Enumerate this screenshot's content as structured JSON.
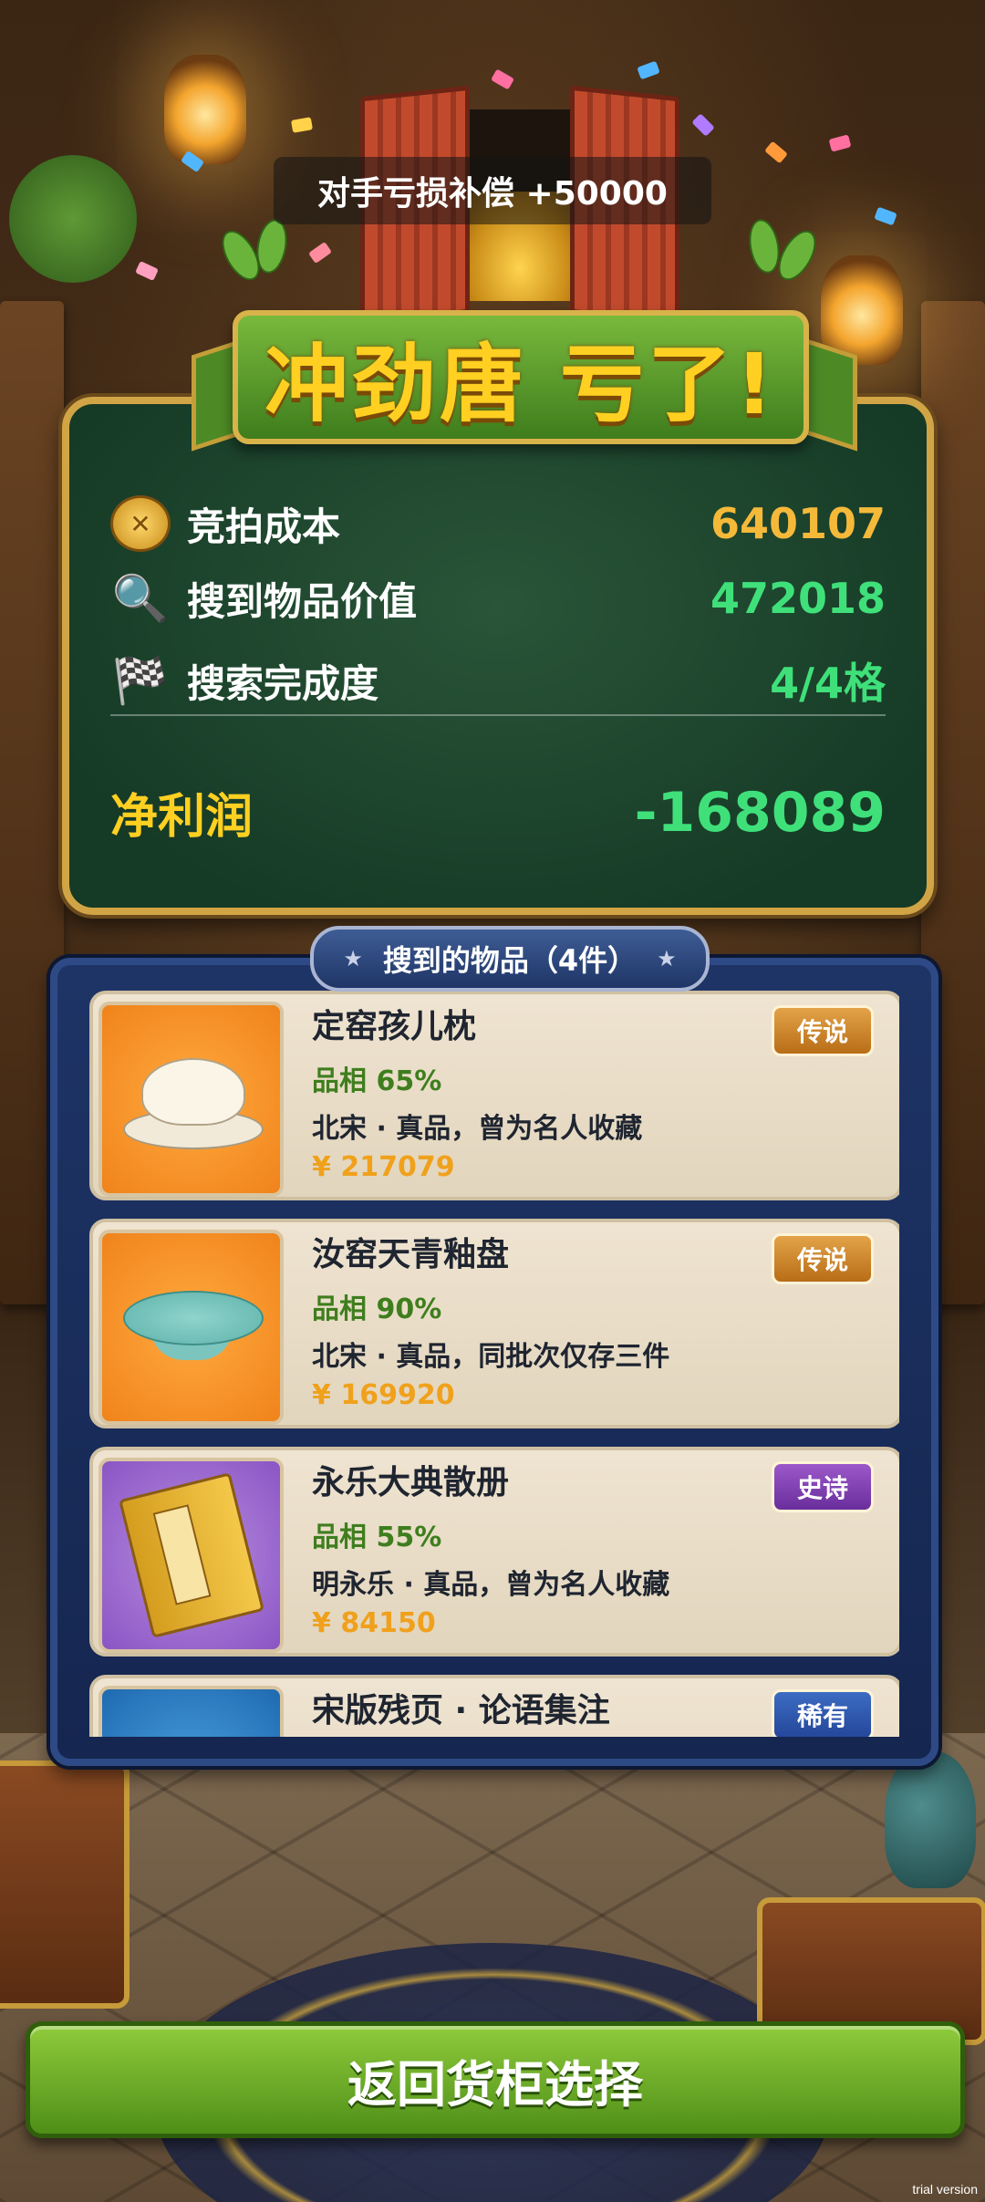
{
  "compensation_text": "对手亏损补偿 +50000",
  "result_title": "冲劲唐 亏了!",
  "stats": {
    "cost": {
      "icon": "coins-icon",
      "label": "竞拍成本",
      "value": "640107",
      "color": "#f5b93a"
    },
    "found_value": {
      "icon": "magnifier-icon",
      "label": "搜到物品价值",
      "value": "472018",
      "color": "#3fe07a"
    },
    "completion": {
      "icon": "checkered-flag-icon",
      "label": "搜索完成度",
      "value": "4/4格",
      "color": "#3fe07a"
    },
    "net_profit": {
      "label": "净利润",
      "value": "-168089",
      "color": "#3fe07a"
    }
  },
  "items_panel": {
    "title": "搜到的物品（4件）",
    "items": [
      {
        "name": "定窑孩儿枕",
        "condition": "品相 65%",
        "description": "北宋 · 真品，曾为名人收藏",
        "price": "¥ 217079",
        "rarity": "传说",
        "rarity_style": "legend",
        "thumb_color": "orange",
        "icon": "porcelain-child-pillow-icon"
      },
      {
        "name": "汝窑天青釉盘",
        "condition": "品相 90%",
        "description": "北宋 · 真品，同批次仅存三件",
        "price": "¥ 169920",
        "rarity": "传说",
        "rarity_style": "legend",
        "thumb_color": "orange",
        "icon": "celadon-plate-icon"
      },
      {
        "name": "永乐大典散册",
        "condition": "品相 55%",
        "description": "明永乐 · 真品，曾为名人收藏",
        "price": "¥ 84150",
        "rarity": "史诗",
        "rarity_style": "epic",
        "thumb_color": "purple",
        "icon": "book-volume-icon"
      },
      {
        "name": "宋版残页 · 论语集注",
        "condition": "",
        "description": "",
        "price": "",
        "rarity": "稀有",
        "rarity_style": "rare",
        "thumb_color": "blue",
        "icon": "manuscript-page-icon"
      }
    ]
  },
  "return_button": "返回货柜选择",
  "watermark": "trial version"
}
